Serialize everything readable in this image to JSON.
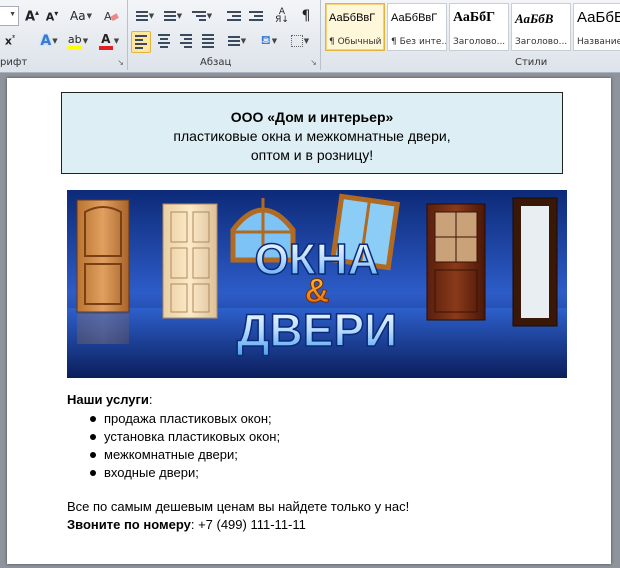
{
  "ribbon": {
    "font_group_label": "рифт",
    "paragraph_group_label": "Абзац",
    "styles_group_label": "Стили",
    "styles": [
      {
        "sample": "АаБбВвГ",
        "name": "¶ Обычный"
      },
      {
        "sample": "АаБбВвГ",
        "name": "¶ Без инте..."
      },
      {
        "sample": "АаБбГ",
        "name": "Заголово..."
      },
      {
        "sample": "АаБбВ",
        "name": "Заголово..."
      },
      {
        "sample": "АаБбВ",
        "name": "Название"
      }
    ]
  },
  "document": {
    "header_line1": "ООО «Дом и интерьер»",
    "header_line2": "пластиковые окна и  межкомнатные двери,",
    "header_line3": "оптом и в розницу!",
    "banner": {
      "word1": "ОКНА",
      "amp": "&",
      "word2": "ДВЕРИ"
    },
    "services_title": "Наши услуги",
    "services_colon": ":",
    "services": [
      "продажа пластиковых окон;",
      "установка пластиковых окон;",
      "межкомнатные двери;",
      "входные двери;"
    ],
    "promo": "Все по самым дешевым ценам вы найдете только у нас!",
    "phone_label": "Звоните по номеру",
    "phone_value": ": +7 (499) 111-11-11"
  },
  "colors": {
    "ribbon_bg": "#e4e9ef",
    "active_button": "#fde7a0",
    "header_fill": "#ddeef4",
    "banner_blue": "#1a3f9a",
    "workspace": "#8f949c"
  }
}
